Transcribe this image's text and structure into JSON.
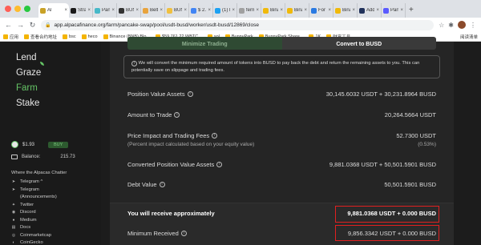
{
  "browser": {
    "tabs": [
      {
        "label": "Al",
        "active": true,
        "color": "#c9a227"
      },
      {
        "label": "Strat",
        "color": "#1a1a1a"
      },
      {
        "label": "Panc",
        "color": "#47b8c8"
      },
      {
        "label": "BUN",
        "color": "#333333"
      },
      {
        "label": "Belt",
        "color": "#e8a33d"
      },
      {
        "label": "BUN",
        "color": "#f0c040"
      },
      {
        "label": "$ 2.6",
        "color": "#4285f4"
      },
      {
        "label": "(1) H",
        "color": "#1da1f2"
      },
      {
        "label": "ferm",
        "color": "#a0a0a0"
      },
      {
        "label": "Binar",
        "color": "#f0b90b"
      },
      {
        "label": "Binar",
        "color": "#f0b90b"
      },
      {
        "label": "ForTu",
        "color": "#2a7ae2"
      },
      {
        "label": "Binar",
        "color": "#f0b90b"
      },
      {
        "label": "Addr",
        "color": "#21325b"
      },
      {
        "label": "Pang",
        "color": "#5a5aff"
      }
    ],
    "new_tab": "+",
    "url": "app.alpacafinance.org/farm/pancake-swap/pool/usdt-busd/worker/usdt-busd/12869/close",
    "bookmarks": [
      "应用",
      "查看合约地址",
      "bsc",
      "heco",
      "Binance (BNB) Blo...",
      "$59,761.22 WBTC...",
      "sol",
      "BunnyPark",
      "BunnyPark Share...",
      "1K",
      "财富工具"
    ],
    "reading_list": "阅读清单"
  },
  "sidebar": {
    "nav": [
      "Lend",
      "Graze",
      "Farm",
      "Stake"
    ],
    "price": "$1.93",
    "buy_label": "BUY",
    "balance_label": "Balance:",
    "balance_value": "215.73",
    "chatter_heading": "Where the Alpacas Chatter",
    "links": [
      {
        "label": "Telegram ^",
        "icon": "telegram-icon",
        "glyph": "➤"
      },
      {
        "label": "Telegram",
        "icon": "telegram-icon",
        "glyph": "➤"
      },
      {
        "label": "(Announcements)",
        "icon": "",
        "glyph": ""
      },
      {
        "label": "Twitter",
        "icon": "twitter-icon",
        "glyph": "✦"
      },
      {
        "label": "Discord",
        "icon": "discord-icon",
        "glyph": "◉"
      },
      {
        "label": "Medium",
        "icon": "medium-icon",
        "glyph": "●"
      },
      {
        "label": "Docs",
        "icon": "docs-icon",
        "glyph": "▤"
      },
      {
        "label": "Coinmarketcap",
        "icon": "coinmarketcap-icon",
        "glyph": "◎"
      },
      {
        "label": "CoinGecko",
        "icon": "coingecko-icon",
        "glyph": "◐"
      }
    ]
  },
  "main": {
    "tabs": {
      "minimize": "Minimize Trading",
      "convert": "Convert to BUSD"
    },
    "notice": "We will convert the minimum required amount of tokens into BUSD to pay back the debt and return the remaining assets to you. This can potentially save on slippage and trading fees.",
    "rows": {
      "position_value": {
        "label": "Position Value Assets",
        "value": "30,145.6032 USDT + 30,231.8964 BUSD"
      },
      "amount_to_trade": {
        "label": "Amount to Trade",
        "value": "20,264.5664 USDT"
      },
      "price_impact": {
        "label": "Price Impact and Trading Fees",
        "value": "52.7300 USDT",
        "sub_label": "(Percent impact calculated based on your equity value)",
        "sub_value": "(0.53%)"
      },
      "converted": {
        "label": "Converted Position Value Assets",
        "value": "9,881.0368 USDT + 50,501.5901 BUSD"
      },
      "debt": {
        "label": "Debt Value",
        "value": "50,501.5901 BUSD"
      },
      "receive": {
        "label": "You will receive approximately",
        "value": "9,881.0368 USDT + 0.000 BUSD"
      },
      "minimum": {
        "label": "Minimum Received",
        "value": "9,856.3342 USDT + 0.000 BUSD"
      }
    }
  },
  "colors": {
    "accent": "#65c466",
    "highlight": "#e02020",
    "background": "#1a1a1a"
  }
}
